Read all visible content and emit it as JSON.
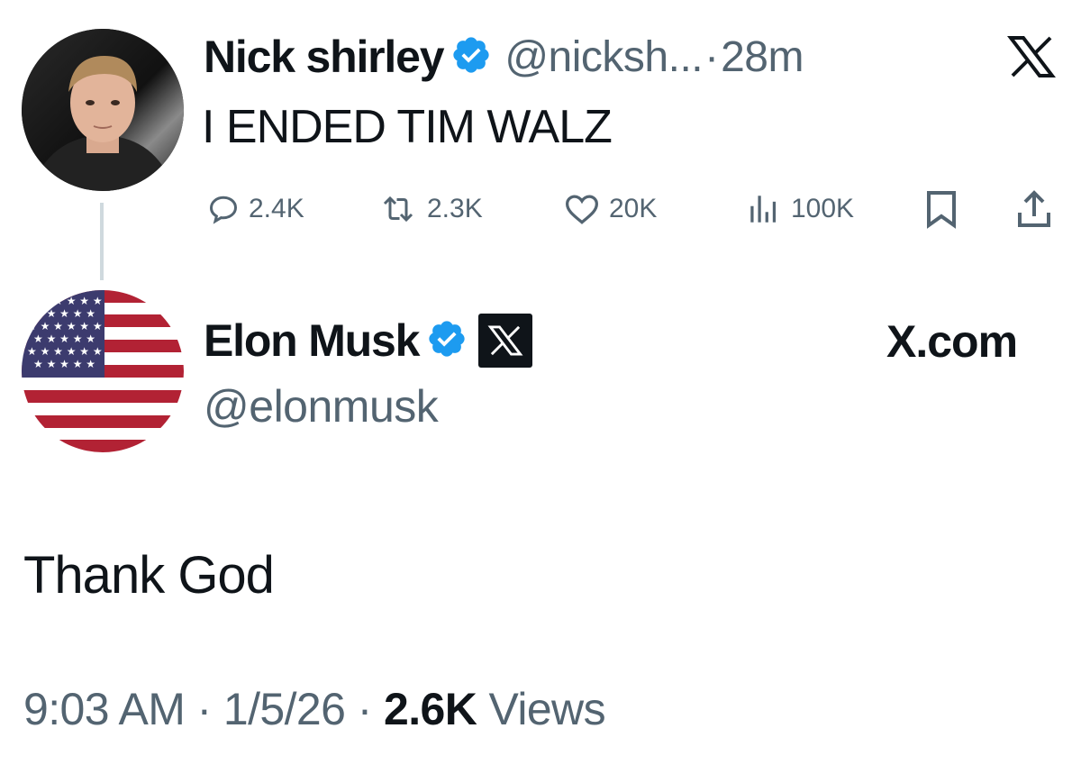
{
  "parent_tweet": {
    "author_name": "Nick shirley",
    "handle": "@nicksh...",
    "separator": "·",
    "time": "28m",
    "text": "I ENDED TIM WALZ",
    "platform_icon": "x-logo-icon",
    "actions": {
      "replies": "2.4K",
      "reposts": "2.3K",
      "likes": "20K",
      "views": "100K"
    }
  },
  "reply_tweet": {
    "author_name": "Elon Musk",
    "handle": "@elonmusk",
    "link_text": "X.com",
    "text": "Thank God",
    "time": "9:03 AM",
    "date": "1/5/26",
    "views_count": "2.6K",
    "views_label": "Views",
    "separator": "·"
  },
  "colors": {
    "text_primary": "#0f1419",
    "text_secondary": "#536471",
    "verified_blue": "#1d9bf0",
    "thread_line": "#cfd9de",
    "flag_red": "#b22234",
    "flag_blue": "#3c3b6e"
  }
}
